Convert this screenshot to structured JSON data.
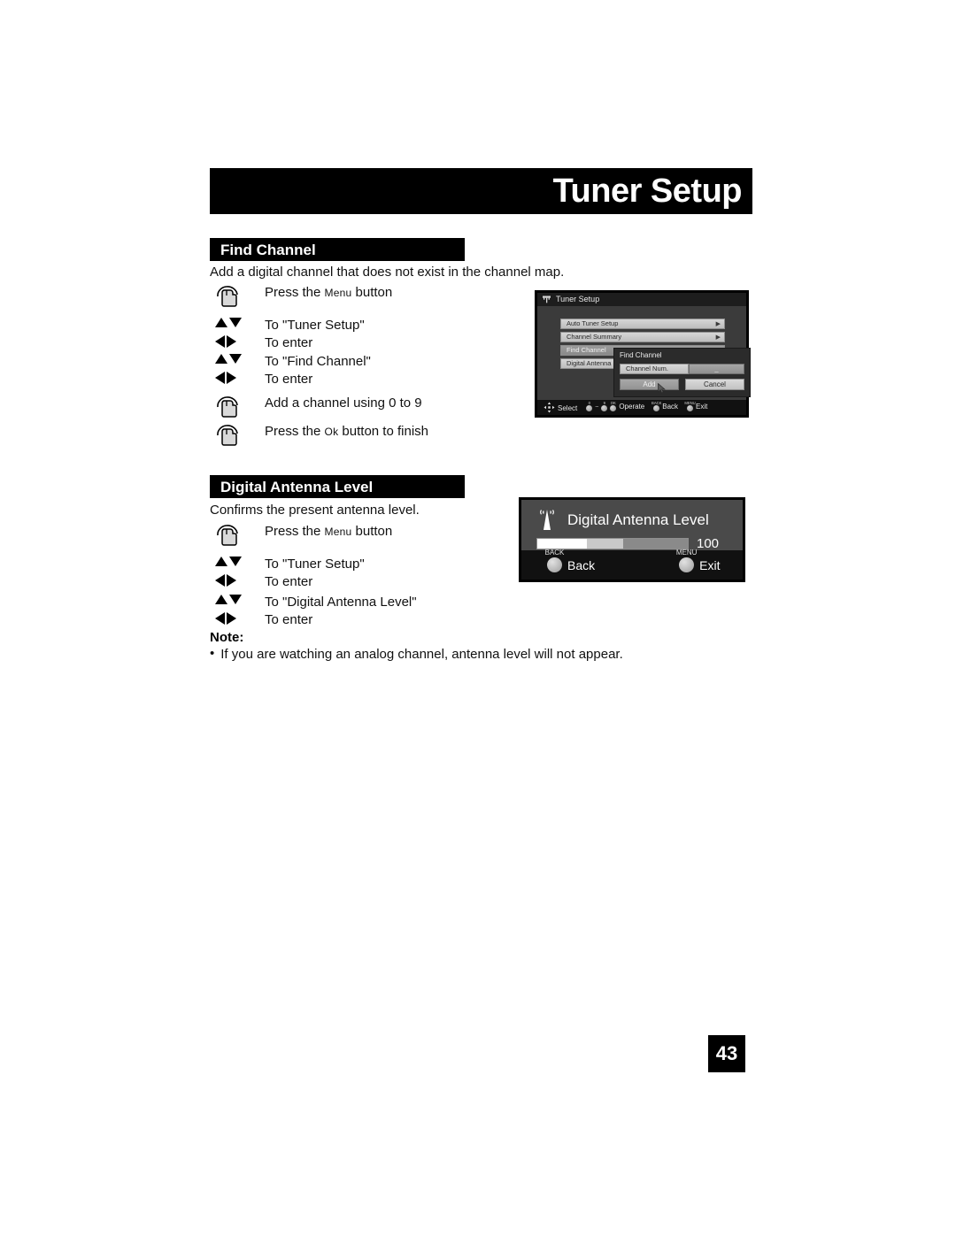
{
  "page": {
    "title": "Tuner Setup",
    "number": "43"
  },
  "sections": [
    {
      "heading": "Find Channel",
      "intro": "Add a digital channel that does not exist in the channel map.",
      "steps": [
        {
          "icon": "hand-press-icon",
          "text_pre": "Press the ",
          "text_small": "Menu",
          "text_post": " button"
        },
        {
          "icon": "up-down-arrows-icon",
          "text": "To \"Tuner Setup\""
        },
        {
          "icon": "left-right-arrows-icon",
          "text": "To enter"
        },
        {
          "icon": "up-down-arrows-icon",
          "text": "To \"Find Channel\""
        },
        {
          "icon": "left-right-arrows-icon",
          "text": "To enter"
        },
        {
          "icon": "hand-press-icon",
          "text": "Add a channel using 0 to 9"
        },
        {
          "icon": "hand-press-icon",
          "text_pre": "Press the ",
          "text_small": "Ok",
          "text_post": " button to finish"
        }
      ]
    },
    {
      "heading": "Digital Antenna Level",
      "intro": "Confirms the present antenna level.",
      "steps": [
        {
          "icon": "hand-press-icon",
          "text_pre": "Press the ",
          "text_small": "Menu",
          "text_post": " button"
        },
        {
          "icon": "up-down-arrows-icon",
          "text": "To \"Tuner Setup\""
        },
        {
          "icon": "left-right-arrows-icon",
          "text": "To enter"
        },
        {
          "icon": "up-down-arrows-icon",
          "text": "To \"Digital Antenna Level\""
        },
        {
          "icon": "left-right-arrows-icon",
          "text": "To enter"
        }
      ]
    }
  ],
  "note": {
    "title": "Note:",
    "bullet": "•",
    "items": [
      "If you are watching an analog channel, antenna level will not appear."
    ]
  },
  "tv_mockup": {
    "titlebar": {
      "icon": "antenna-icon",
      "title": "Tuner Setup"
    },
    "menu_items": [
      {
        "label": "Auto Tuner Setup",
        "arrow": "▶",
        "selected": false
      },
      {
        "label": "Channel Summary",
        "arrow": "▶",
        "selected": false
      },
      {
        "label": "Find Channel",
        "arrow": "▶",
        "selected": true
      },
      {
        "label": "Digital Antenna",
        "arrow": "▶",
        "selected": false
      }
    ],
    "dialog": {
      "title": "Find Channel",
      "field_label": "Channel Num.",
      "field_value": "_",
      "add_button": "Add",
      "cancel_button": "Cancel"
    },
    "bottom_bar": [
      {
        "key": "select",
        "label": "Select",
        "icon": "four-way-arrows-icon"
      },
      {
        "key": "operate",
        "label": "Operate",
        "dots": [
          "0",
          "9",
          "OK"
        ],
        "dash": "~"
      },
      {
        "key": "back",
        "label": "Back",
        "dots": [
          "BACK"
        ]
      },
      {
        "key": "exit",
        "label": "Exit",
        "dots": [
          "MENU"
        ]
      }
    ]
  },
  "antenna_panel": {
    "icon": "antenna-signal-icon",
    "title": "Digital Antenna Level",
    "value": "100",
    "segments": [
      {
        "name": "segment-high",
        "width_pct": 33,
        "color": "#ffffff"
      },
      {
        "name": "segment-mid",
        "width_pct": 24,
        "color": "#c9c9c9"
      },
      {
        "name": "segment-low",
        "width_pct": 43,
        "color": "#8a8a8a"
      }
    ],
    "buttons": [
      {
        "cap": "BACK",
        "label": "Back"
      },
      {
        "cap": "MENU",
        "label": "Exit"
      }
    ]
  }
}
